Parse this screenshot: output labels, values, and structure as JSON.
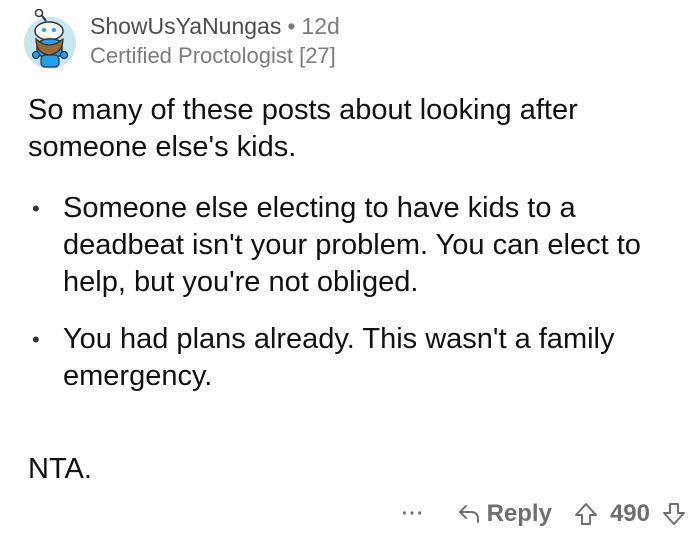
{
  "comment": {
    "username": "ShowUsYaNungas",
    "separator": "•",
    "age": "12d",
    "flair": "Certified Proctologist [27]",
    "intro": "So many of these posts about looking after someone else's kids.",
    "bullets": [
      "Someone else electing to have kids to a deadbeat isn't your problem. You can elect to help, but you're not obliged.",
      "You had plans already. This wasn't a family emergency."
    ],
    "bullet_marker": "•",
    "closing": "NTA."
  },
  "actions": {
    "more_label": "···",
    "reply_label": "Reply",
    "score": "490"
  },
  "icons": {
    "avatar": "snoo-avatar-icon",
    "reply": "reply-arrow-icon",
    "upvote": "upvote-arrow-icon",
    "downvote": "downvote-arrow-icon"
  },
  "colors": {
    "meta_text": "#787c7e",
    "body_text": "#111111",
    "action_text": "#6c6f72",
    "avatar_bg": "#c6e6f0",
    "avatar_body": "#24a0ed"
  }
}
